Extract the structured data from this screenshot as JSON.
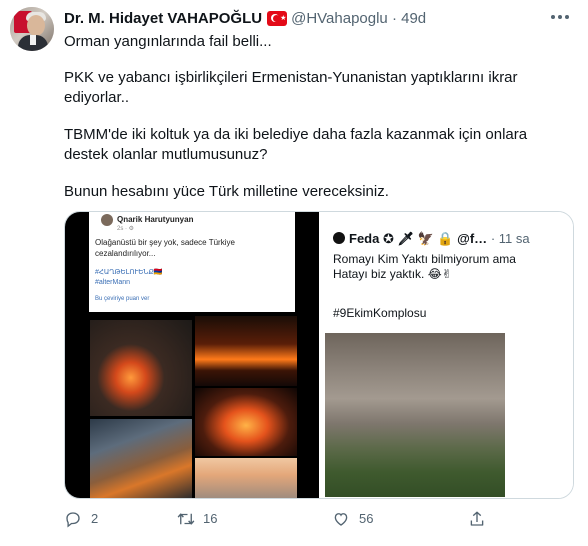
{
  "tweet": {
    "author": {
      "name": "Dr. M. Hidayet VAHAPOĞLU",
      "handle": "@HVahapoglu",
      "separator": "·",
      "time": "49d",
      "avatar_icon": "profile-photo",
      "flag_icon": "turkey-flag-icon"
    },
    "text": {
      "line1": "Orman yangınlarında fail belli...",
      "line2": "PKK ve yabancı işbirlikçileri Ermenistan-Yunanistan yaptıklarını ikrar ediyorlar..",
      "line3": "TBMM'de iki koltuk ya da iki belediye daha fazla kazanmak için onlara destek olanlar mutlumusunuz?",
      "line4": "Bunun hesabını yüce Türk milletine vereceksiniz."
    },
    "media": {
      "left_image": {
        "post_author": "Qnarik Harutyunyan",
        "post_time": "2s · ⚙",
        "post_text": "Olağanüstü bir şey yok, sadece Türkiye cezalandırılıyor...",
        "post_tag1": "#ՀԱՂԹԵԼՈՒԵՆՔ🇦🇲",
        "post_tag2": "#alterMann",
        "post_translate": "Bu çeviriye puan ver"
      },
      "right_image": {
        "author": "Feda ✪ 🗡 🦅 🔒 @f…",
        "time": "· 11 sa",
        "text": "Romayı Kim Yaktı bilmiyorum ama\nHatayı biz yaktık. 😂✌",
        "hashtag": "#9EkimKomplosu"
      }
    },
    "actions": {
      "reply_count": "2",
      "retweet_count": "16",
      "like_count": "56",
      "reply_icon": "reply-icon",
      "retweet_icon": "retweet-icon",
      "like_icon": "heart-icon",
      "share_icon": "share-icon"
    },
    "more_icon": "more-icon"
  },
  "colors": {
    "text_primary": "#0f1419",
    "text_secondary": "#536471",
    "border": "#cfd9de",
    "flag_red": "#e30a17"
  }
}
